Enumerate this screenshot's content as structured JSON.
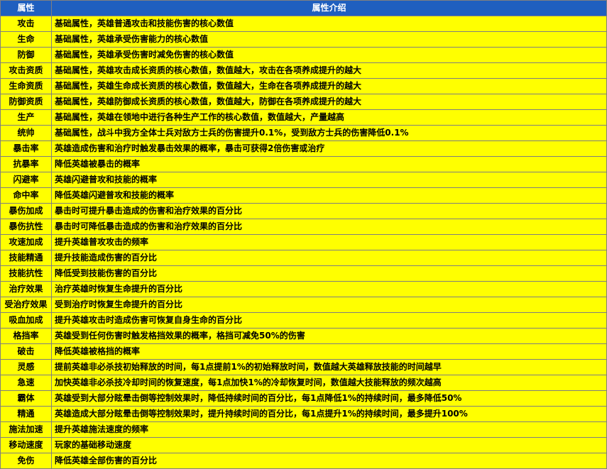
{
  "header": {
    "attr": "属性",
    "desc": "属性介绍"
  },
  "rows": [
    {
      "name": "攻击",
      "desc": "基础属性，英雄普通攻击和技能伤害的核心数值"
    },
    {
      "name": "生命",
      "desc": "基础属性，英雄承受伤害能力的核心数值"
    },
    {
      "name": "防御",
      "desc": "基础属性，英雄承受伤害时减免伤害的核心数值"
    },
    {
      "name": "攻击资质",
      "desc": "基础属性，英雄攻击成长资质的核心数值，数值越大，攻击在各项养成提升的越大"
    },
    {
      "name": "生命资质",
      "desc": "基础属性，英雄生命成长资质的核心数值，数值越大，生命在各项养成提升的越大"
    },
    {
      "name": "防御资质",
      "desc": "基础属性，英雄防御成长资质的核心数值，数值越大，防御在各项养成提升的越大"
    },
    {
      "name": "生产",
      "desc": "基础属性，英雄在领地中进行各种生产工作的核心数值，数值越大，产量越高"
    },
    {
      "name": "统帅",
      "desc": "基础属性，战斗中我方全体士兵对敌方士兵的伤害提升0.1%，受到敌方士兵的伤害降低0.1%"
    },
    {
      "name": "暴击率",
      "desc": "英雄造成伤害和治疗时触发暴击效果的概率，暴击可获得2倍伤害或治疗"
    },
    {
      "name": "抗暴率",
      "desc": "降低英雄被暴击的概率"
    },
    {
      "name": "闪避率",
      "desc": "英雄闪避普攻和技能的概率"
    },
    {
      "name": "命中率",
      "desc": "降低英雄闪避普攻和技能的概率"
    },
    {
      "name": "暴伤加成",
      "desc": "暴击时可提升暴击造成的伤害和治疗效果的百分比"
    },
    {
      "name": "暴伤抗性",
      "desc": "暴击时可降低暴击造成的伤害和治疗效果的百分比"
    },
    {
      "name": "攻速加成",
      "desc": "提升英雄普攻攻击的频率"
    },
    {
      "name": "技能精通",
      "desc": "提升技能造成伤害的百分比"
    },
    {
      "name": "技能抗性",
      "desc": "降低受到技能伤害的百分比"
    },
    {
      "name": "治疗效果",
      "desc": "治疗英雄时恢复生命提升的百分比"
    },
    {
      "name": "受治疗效果",
      "desc": "受到治疗时恢复生命提升的百分比"
    },
    {
      "name": "吸血加成",
      "desc": "提升英雄攻击时造成伤害可恢复自身生命的百分比"
    },
    {
      "name": "格挡率",
      "desc": "英雄受到任何伤害时触发格挡效果的概率，格挡可减免50%的伤害"
    },
    {
      "name": "破击",
      "desc": "降低英雄被格挡的概率"
    },
    {
      "name": "灵感",
      "desc": "提前英雄非必杀技初始释放的时间，每1点提前1%的初始释放时间，数值越大英雄释放技能的时间越早"
    },
    {
      "name": "急速",
      "desc": "加快英雄非必杀技冷却时间的恢复速度，每1点加快1%的冷却恢复时间，数值越大技能释放的频次越高"
    },
    {
      "name": "霸体",
      "desc": "英雄受到大部分眩晕击倒等控制效果时，降低持续时间的百分比，每1点降低1%的持续时间，最多降低50%"
    },
    {
      "name": "精通",
      "desc": "英雄造成大部分眩晕击倒等控制效果时，提升持续时间的百分比，每1点提升1%的持续时间，最多提升100%"
    },
    {
      "name": "施法加速",
      "desc": "提升英雄施法速度的频率"
    },
    {
      "name": "移动速度",
      "desc": "玩家的基础移动速度"
    },
    {
      "name": "免伤",
      "desc": "降低英雄全部伤害的百分比"
    }
  ],
  "colors": {
    "header_bg": "#1f5fbf",
    "header_text": "#ffffff",
    "cell_bg": "#ffff00",
    "border": "#7f7f7f"
  }
}
